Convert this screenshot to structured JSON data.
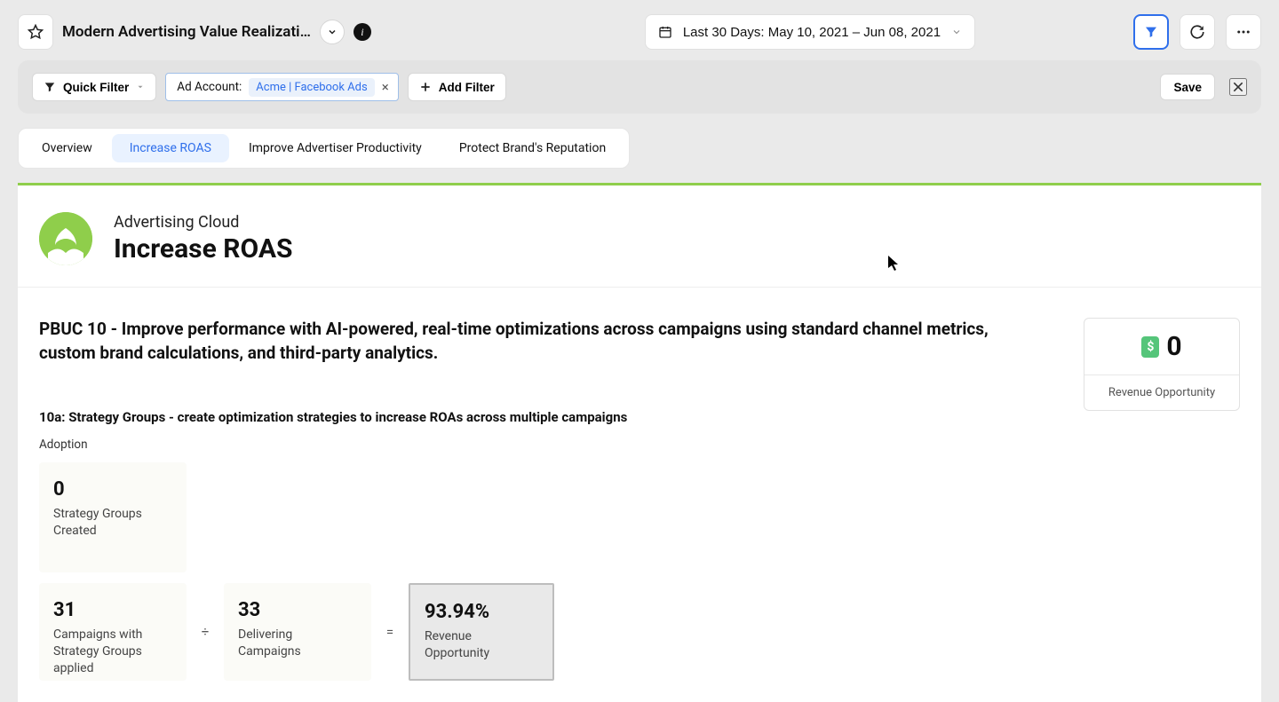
{
  "header": {
    "title": "Modern Advertising Value Realizati…",
    "date_range_text": "Last 30 Days: May 10, 2021 – Jun 08, 2021"
  },
  "filterbar": {
    "quick_filter_label": "Quick Filter",
    "ad_account_label": "Ad Account:",
    "ad_account_value": "Acme | Facebook Ads",
    "add_filter_label": "Add Filter",
    "save_label": "Save"
  },
  "tabs": [
    {
      "label": "Overview"
    },
    {
      "label": "Increase ROAS"
    },
    {
      "label": "Improve Advertiser Productivity"
    },
    {
      "label": "Protect Brand's Reputation"
    }
  ],
  "panel": {
    "subtitle": "Advertising Cloud",
    "title": "Increase ROAS",
    "hero_text": "PBUC 10 - Improve performance with AI-powered, real-time optimizations across campaigns using standard channel metrics, custom brand calculations, and third-party analytics."
  },
  "kpi": {
    "currency_icon": "$",
    "value": "0",
    "label": "Revenue Opportunity"
  },
  "section": {
    "title": "10a: Strategy Groups - create optimization strategies to increase ROAs across multiple campaigns",
    "adoption_label": "Adoption",
    "metrics": {
      "strategy_groups": {
        "value": "0",
        "label": "Strategy Groups Created"
      },
      "campaigns_applied": {
        "value": "31",
        "label": "Campaigns with Strategy Groups applied"
      },
      "divide_symbol": "÷",
      "delivering": {
        "value": "33",
        "label": "Delivering Campaigns"
      },
      "equals_symbol": "=",
      "result": {
        "value": "93.94%",
        "label": "Revenue Opportunity"
      }
    }
  }
}
